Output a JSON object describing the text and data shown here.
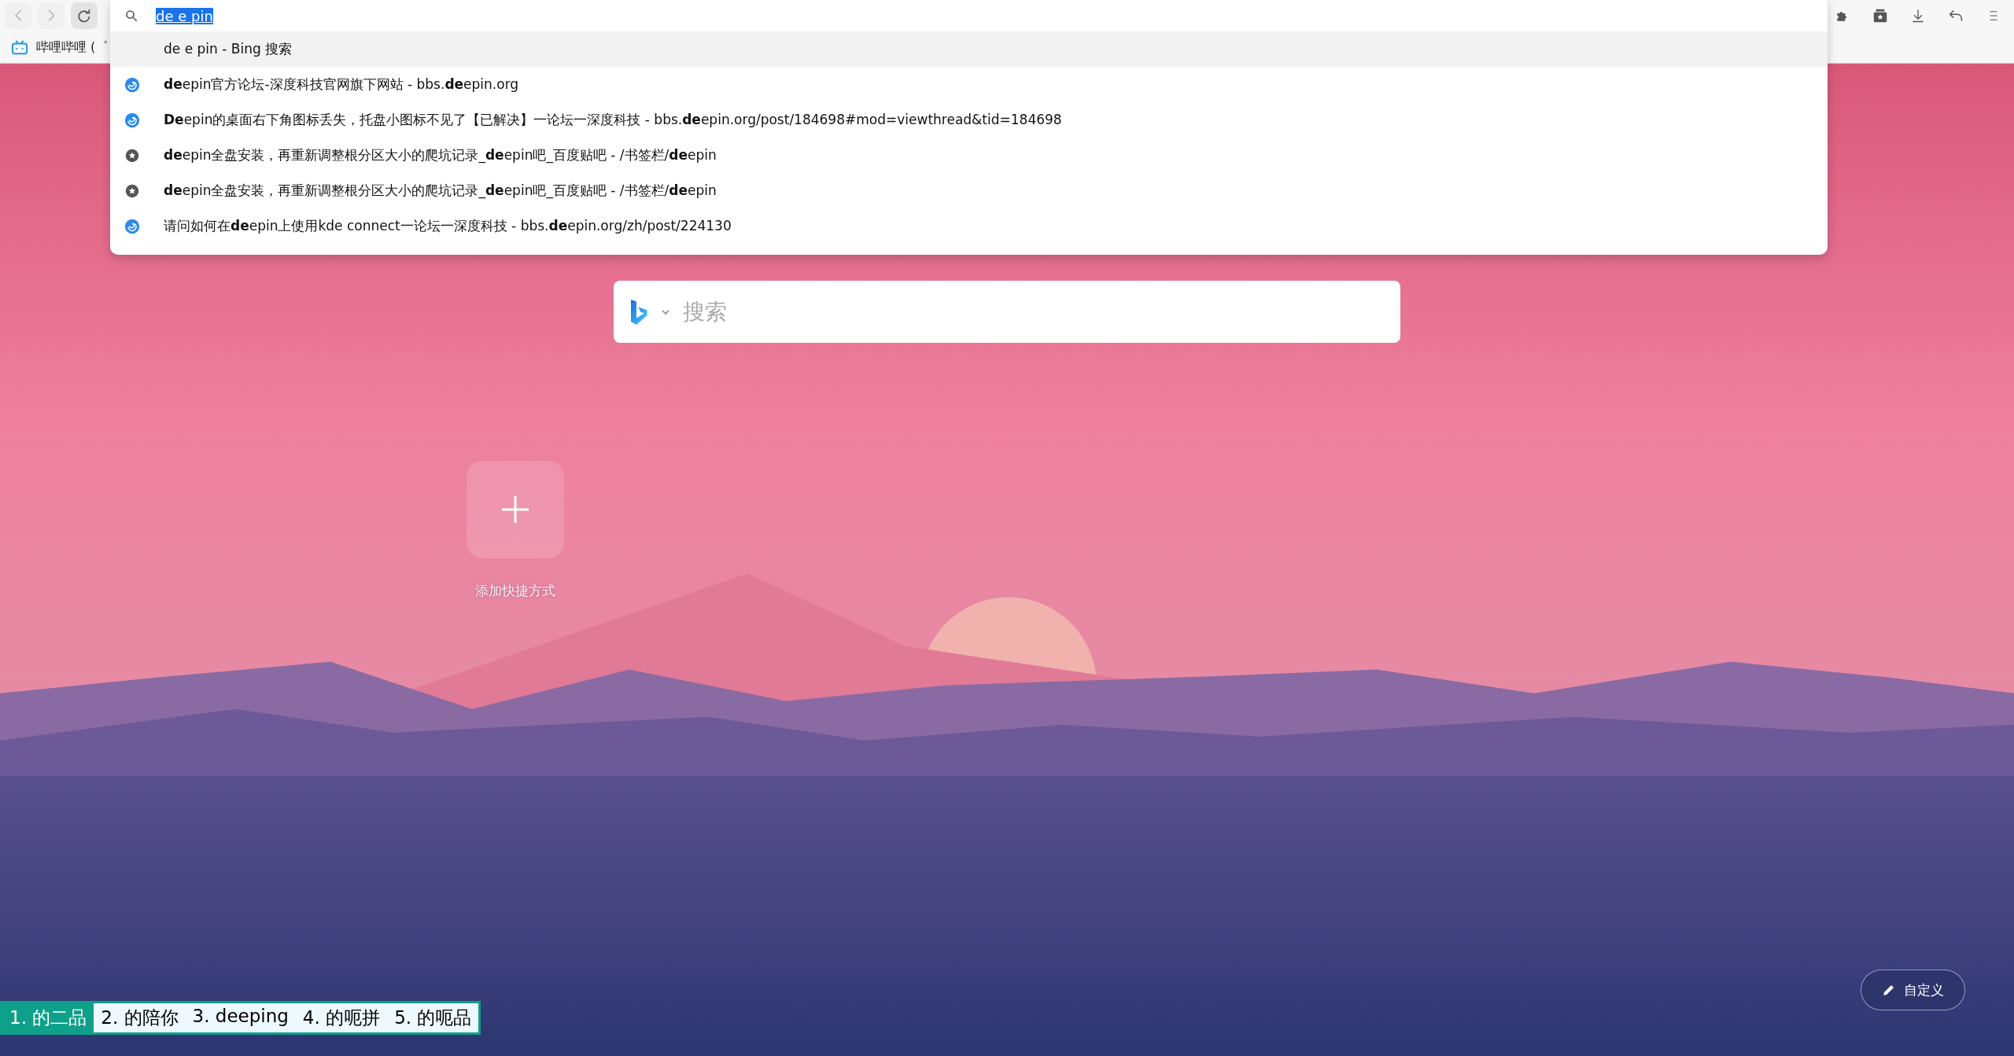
{
  "toolbar": {
    "nav_buttons": [
      {
        "kind": "back",
        "disabled": true
      },
      {
        "kind": "forward",
        "disabled": true
      },
      {
        "kind": "reload",
        "disabled": false
      }
    ],
    "address": {
      "value": "de e pin",
      "text_selected": true
    },
    "actions": [
      {
        "kind": "extensions"
      },
      {
        "kind": "collections"
      },
      {
        "kind": "download"
      },
      {
        "kind": "undo"
      },
      {
        "kind": "menu"
      }
    ]
  },
  "bookmarks": [
    {
      "label": "哔哩哔哩 (゜"
    }
  ],
  "suggestions": [
    {
      "kind": "search",
      "text": "de e pin - Bing 搜索",
      "selected": true
    },
    {
      "kind": "site",
      "text": "**de**epin官方论坛-深度科技官网旗下网站 - bbs.**de**epin.org",
      "selected": false
    },
    {
      "kind": "site",
      "text": "**De**epin的桌面右下角图标丢失，托盘小图标不见了【已解决】一论坛一深度科技 - bbs.**de**epin.org/post/184698#mod=viewthread&tid=184698",
      "selected": false
    },
    {
      "kind": "bookmark",
      "text": "**de**epin全盘安装，再重新调整根分区大小的爬坑记录_**de**epin吧_百度贴吧 - /书签栏/**de**epin",
      "selected": false
    },
    {
      "kind": "bookmark",
      "text": "**de**epin全盘安装，再重新调整根分区大小的爬坑记录_**de**epin吧_百度贴吧 - /书签栏/**de**epin",
      "selected": false
    },
    {
      "kind": "site",
      "text": "请问如何在**de**epin上使用kde connect一论坛一深度科技 - bbs.**de**epin.org/zh/post/224130",
      "selected": false
    }
  ],
  "search_box": {
    "placeholder": "搜索"
  },
  "shortcuts": [
    {
      "kind": "add",
      "label": "添加快捷方式"
    }
  ],
  "customize_button": {
    "label": "自定义"
  },
  "ime_candidates": [
    {
      "text": "1. 的二品",
      "selected": true
    },
    {
      "text": "2. 的陪你",
      "selected": false
    },
    {
      "text": "3. deeping",
      "selected": false
    },
    {
      "text": "4. 的呃拼",
      "selected": false
    },
    {
      "text": "5. 的呃品",
      "selected": false
    }
  ]
}
